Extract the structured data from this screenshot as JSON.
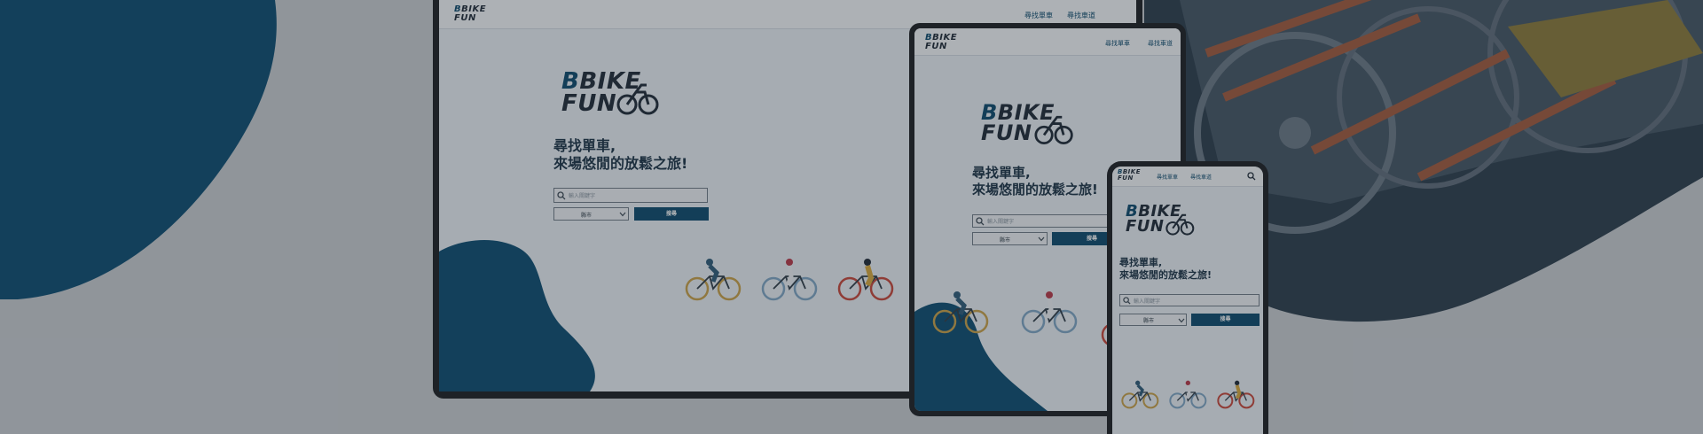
{
  "brand": {
    "logo_text_line1": "BIKE",
    "logo_text_line2": "FUN"
  },
  "nav": {
    "find_bikes": "尋找單車",
    "find_routes": "尋找車道"
  },
  "hero": {
    "slogan_line1": "尋找單車,",
    "slogan_line2": "來場悠閒的放鬆之旅!"
  },
  "search": {
    "placeholder": "輸入關鍵字",
    "city_selected": "縣市",
    "submit_label": "搜尋"
  },
  "icons": [
    "search-icon",
    "chevron-down-icon",
    "bicycle-icon"
  ],
  "colors": {
    "brand_blue": "#0b4a6e",
    "background": "#eaf0f6",
    "dark_text": "#1e2a38"
  }
}
